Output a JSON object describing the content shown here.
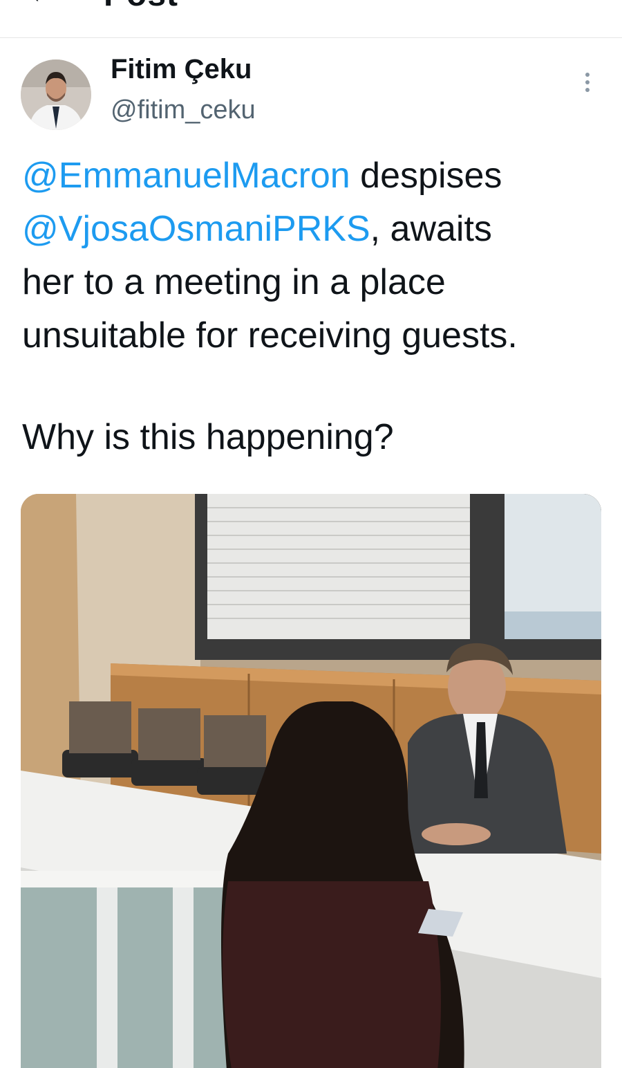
{
  "topbar": {
    "back_icon": "arrow-left-icon",
    "title": "Post"
  },
  "post": {
    "author": {
      "name": "Fitim Çeku",
      "handle": "@fitim_ceku"
    },
    "more_icon": "more-vertical-icon",
    "text": {
      "mention_1": "@EmmanuelMacron",
      "segment_1": " despises",
      "mention_2": "@VjosaOsmaniPRKS",
      "segment_2": ", awaits",
      "line_3": "her to a meeting in a place",
      "line_4": "unsuitable for receiving guests."
    },
    "question": "Why is this happening?"
  },
  "colors": {
    "accent": "#1d9bf0",
    "text": "#0f1419",
    "secondary": "#536471"
  }
}
